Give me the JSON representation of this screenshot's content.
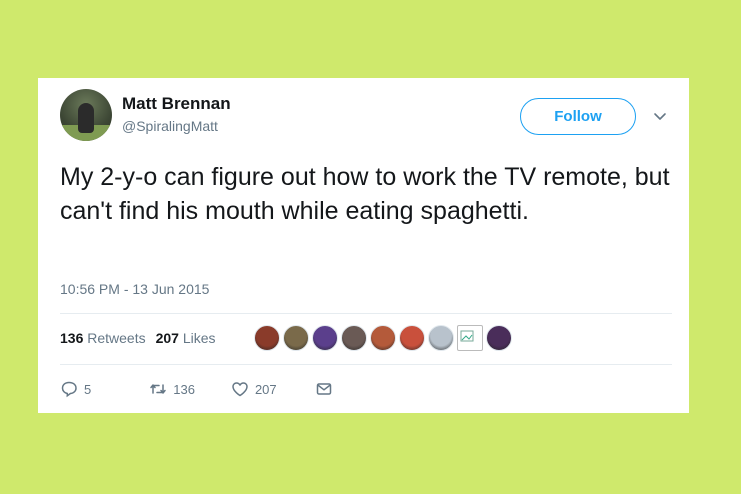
{
  "tweet": {
    "author_name": "Matt Brennan",
    "author_handle": "@SpiralingMatt",
    "follow_label": "Follow",
    "text": "My 2-y-o can figure out how to work the TV remote, but can't find his mouth while eating spaghetti.",
    "timestamp": "10:56 PM - 13 Jun 2015"
  },
  "stats": {
    "retweets_count": "136",
    "retweets_label": "Retweets",
    "likes_count": "207",
    "likes_label": "Likes"
  },
  "likers": [
    {
      "name": "liker-avatar-1",
      "color": "#8a3b2a"
    },
    {
      "name": "liker-avatar-2",
      "color": "#7a6a4a"
    },
    {
      "name": "liker-avatar-3",
      "color": "#5b3f8c"
    },
    {
      "name": "liker-avatar-4",
      "color": "#6a5a55"
    },
    {
      "name": "liker-avatar-5",
      "color": "#b45a3a"
    },
    {
      "name": "liker-avatar-6",
      "color": "#c9503c"
    },
    {
      "name": "liker-avatar-7",
      "color": "#b8c2cc"
    },
    {
      "name": "liker-avatar-8",
      "color": "#ffffff"
    },
    {
      "name": "liker-avatar-9",
      "color": "#4a2d5a"
    }
  ],
  "actions": {
    "reply_count": "5",
    "retweet_count": "136",
    "like_count": "207"
  },
  "colors": {
    "background": "#cfe96c",
    "accent": "#1da1f2",
    "text": "#14171a",
    "muted": "#657786"
  }
}
